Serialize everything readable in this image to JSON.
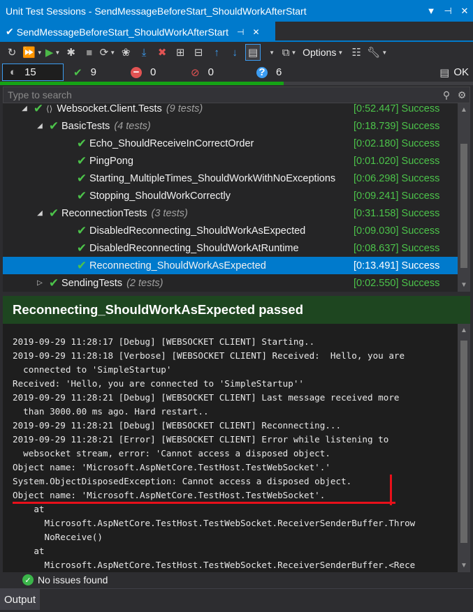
{
  "window": {
    "title": "Unit Test Sessions - SendMessageBeforeStart_ShouldWorkAfterStart",
    "dropdown_icon": "dropdown-arrow-icon",
    "pin_icon": "pin-icon",
    "close_icon": "close-icon"
  },
  "tab": {
    "title": "SendMessageBeforeStart_ShouldWorkAfterStart",
    "pin": "⊣",
    "close": "✕"
  },
  "toolbar": {
    "options_label": "Options"
  },
  "stats": {
    "total": "15",
    "passed": "9",
    "failed": "0",
    "skipped": "0",
    "not_run": "6",
    "ok_label": "OK"
  },
  "progress": {
    "passed_fraction": 0.6
  },
  "search": {
    "placeholder": "Type to search"
  },
  "tree": {
    "rows": [
      {
        "expander": "◢",
        "label": "Websocket.Client.Tests",
        "count": "(9 tests)",
        "duration": "[0:52.447] Success",
        "kind": "namespace"
      },
      {
        "expander": "◢",
        "label": "BasicTests",
        "count": "(4 tests)",
        "duration": "[0:18.739] Success",
        "kind": "class"
      },
      {
        "expander": "",
        "label": "Echo_ShouldReceiveInCorrectOrder",
        "count": "",
        "duration": "[0:02.180] Success",
        "kind": "test"
      },
      {
        "expander": "",
        "label": "PingPong",
        "count": "",
        "duration": "[0:01.020] Success",
        "kind": "test"
      },
      {
        "expander": "",
        "label": "Starting_MultipleTimes_ShouldWorkWithNoExceptions",
        "count": "",
        "duration": "[0:06.298] Success",
        "kind": "test"
      },
      {
        "expander": "",
        "label": "Stopping_ShouldWorkCorrectly",
        "count": "",
        "duration": "[0:09.241] Success",
        "kind": "test"
      },
      {
        "expander": "◢",
        "label": "ReconnectionTests",
        "count": "(3 tests)",
        "duration": "[0:31.158] Success",
        "kind": "class"
      },
      {
        "expander": "",
        "label": "DisabledReconnecting_ShouldWorkAsExpected",
        "count": "",
        "duration": "[0:09.030] Success",
        "kind": "test"
      },
      {
        "expander": "",
        "label": "DisabledReconnecting_ShouldWorkAtRuntime",
        "count": "",
        "duration": "[0:08.637] Success",
        "kind": "test"
      },
      {
        "expander": "",
        "label": "Reconnecting_ShouldWorkAsExpected",
        "count": "",
        "duration": "[0:13.491] Success",
        "kind": "test",
        "selected": true
      },
      {
        "expander": "▷",
        "label": "SendingTests",
        "count": "(2 tests)",
        "duration": "[0:02.550] Success",
        "kind": "class"
      }
    ]
  },
  "detail": {
    "header": "Reconnecting_ShouldWorkAsExpected passed",
    "output_lines": [
      "2019-09-29 11:28:17 [Debug] [WEBSOCKET CLIENT] Starting..",
      "2019-09-29 11:28:18 [Verbose] [WEBSOCKET CLIENT] Received:  Hello, you are",
      "  connected to 'SimpleStartup'",
      "Received: 'Hello, you are connected to 'SimpleStartup''",
      "2019-09-29 11:28:21 [Debug] [WEBSOCKET CLIENT] Last message received more",
      "  than 3000.00 ms ago. Hard restart..",
      "2019-09-29 11:28:21 [Debug] [WEBSOCKET CLIENT] Reconnecting...",
      "2019-09-29 11:28:21 [Error] [WEBSOCKET CLIENT] Error while listening to",
      "  websocket stream, error: 'Cannot access a disposed object.",
      "Object name: 'Microsoft.AspNetCore.TestHost.TestWebSocket'.'",
      "System.ObjectDisposedException: Cannot access a disposed object.",
      "Object name: 'Microsoft.AspNetCore.TestHost.TestWebSocket'.",
      "    at",
      "      Microsoft.AspNetCore.TestHost.TestWebSocket.ReceiverSenderBuffer.Throw",
      "      NoReceive()",
      "    at",
      "      Microsoft.AspNetCore.TestHost.TestWebSocket.ReceiverSenderBuffer.<Rece"
    ]
  },
  "status": {
    "text": "No issues found"
  },
  "bottom_tab": {
    "label": "Output"
  },
  "colors": {
    "accent": "#007acc",
    "success": "#4cc34a",
    "detail_header_bg": "#1e4620",
    "annotation_red": "#e8101a"
  }
}
